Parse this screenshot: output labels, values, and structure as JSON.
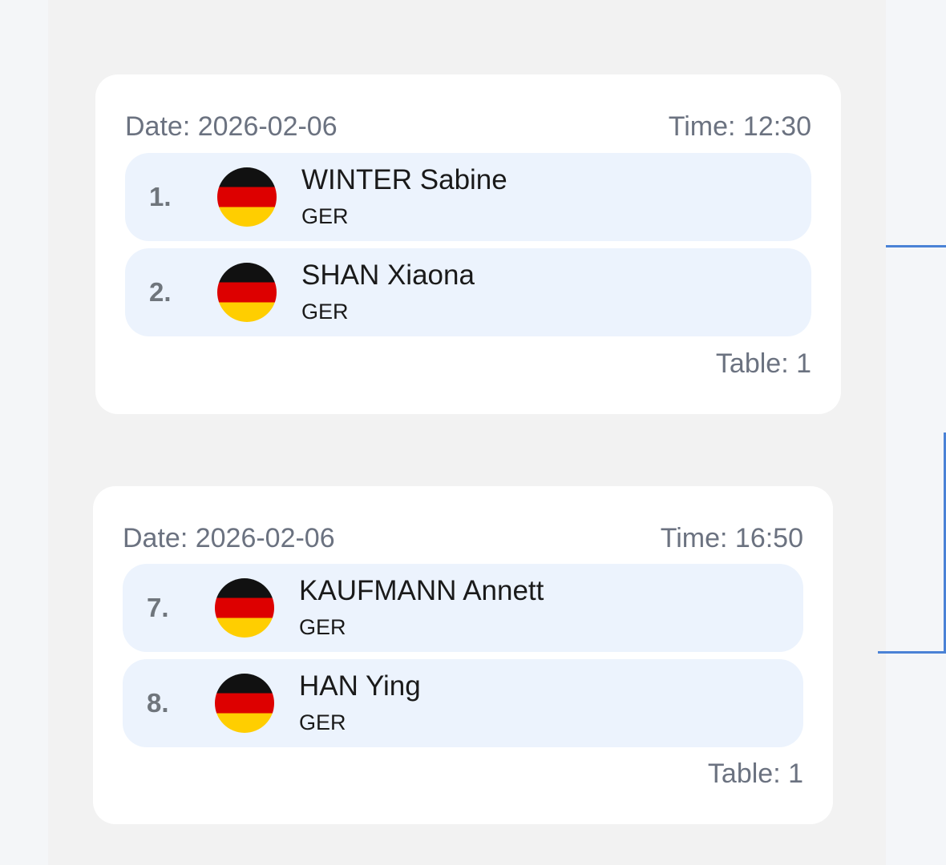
{
  "colors": {
    "bracket_line": "#4a82d6",
    "row_background": "#ecf3fd",
    "card_background": "#ffffff",
    "page_background": "#f2f2f2"
  },
  "matches": [
    {
      "date": "Date: 2026-02-06",
      "time": "Time: 12:30",
      "table": "Table: 1",
      "players": [
        {
          "seed": "1.",
          "name": "WINTER Sabine",
          "country": "GER",
          "flag": "germany-flag-icon"
        },
        {
          "seed": "2.",
          "name": "SHAN Xiaona",
          "country": "GER",
          "flag": "germany-flag-icon"
        }
      ]
    },
    {
      "date": "Date: 2026-02-06",
      "time": "Time: 16:50",
      "table": "Table: 1",
      "players": [
        {
          "seed": "7.",
          "name": "KAUFMANN Annett",
          "country": "GER",
          "flag": "germany-flag-icon"
        },
        {
          "seed": "8.",
          "name": "HAN Ying",
          "country": "GER",
          "flag": "germany-flag-icon"
        }
      ]
    }
  ]
}
